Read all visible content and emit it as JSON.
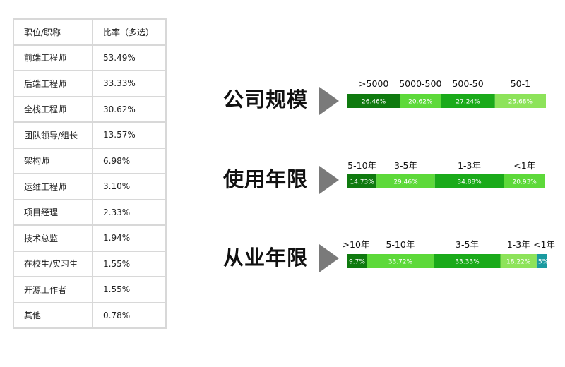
{
  "table": {
    "header": [
      "职位/职称",
      "比率（多选）"
    ],
    "rows": [
      [
        "前端工程师",
        "53.49%"
      ],
      [
        "后端工程师",
        "33.33%"
      ],
      [
        "全栈工程师",
        "30.62%"
      ],
      [
        "团队领导/组长",
        "13.57%"
      ],
      [
        "架构师",
        "6.98%"
      ],
      [
        "运维工程师",
        "3.10%"
      ],
      [
        "项目经理",
        "2.33%"
      ],
      [
        "技术总监",
        "1.94%"
      ],
      [
        "在校生/实习生",
        "1.55%"
      ],
      [
        "开源工作者",
        "1.55%"
      ],
      [
        "其他",
        "0.78%"
      ]
    ]
  },
  "colors": {
    "dark_green": "#0f7a0f",
    "mid_green": "#1aaa1a",
    "light_green": "#5dd93a",
    "pale_green": "#8de35a",
    "teal": "#1a9aa0",
    "arrow": "#7a7a7a"
  },
  "chart_data": [
    {
      "type": "bar",
      "title": "公司规模",
      "categories": [
        ">5000",
        "5000-500",
        "500-50",
        "50-1"
      ],
      "values": [
        26.46,
        20.62,
        27.24,
        25.68
      ],
      "value_labels": [
        "26.46%",
        "20.62%",
        "27.24%",
        "25.68%"
      ],
      "colors": [
        "#0f7a0f",
        "#5dd93a",
        "#1aaa1a",
        "#8de35a"
      ]
    },
    {
      "type": "bar",
      "title": "使用年限",
      "categories": [
        "5-10年",
        "3-5年",
        "1-3年",
        "<1年"
      ],
      "values": [
        14.73,
        29.46,
        34.88,
        20.93
      ],
      "value_labels": [
        "14.73%",
        "29.46%",
        "34.88%",
        "20.93%"
      ],
      "colors": [
        "#0f7a0f",
        "#5dd93a",
        "#1aaa1a",
        "#5dd93a"
      ]
    },
    {
      "type": "bar",
      "title": "从业年限",
      "categories": [
        ">10年",
        "5-10年",
        "3-5年",
        "1-3年",
        "<1年"
      ],
      "values": [
        9.7,
        33.72,
        33.33,
        18.22,
        5
      ],
      "value_labels": [
        "9.7%",
        "33.72%",
        "33.33%",
        "18.22%",
        "5%"
      ],
      "colors": [
        "#0f7a0f",
        "#5dd93a",
        "#1aaa1a",
        "#8de35a",
        "#1a9aa0"
      ]
    }
  ]
}
